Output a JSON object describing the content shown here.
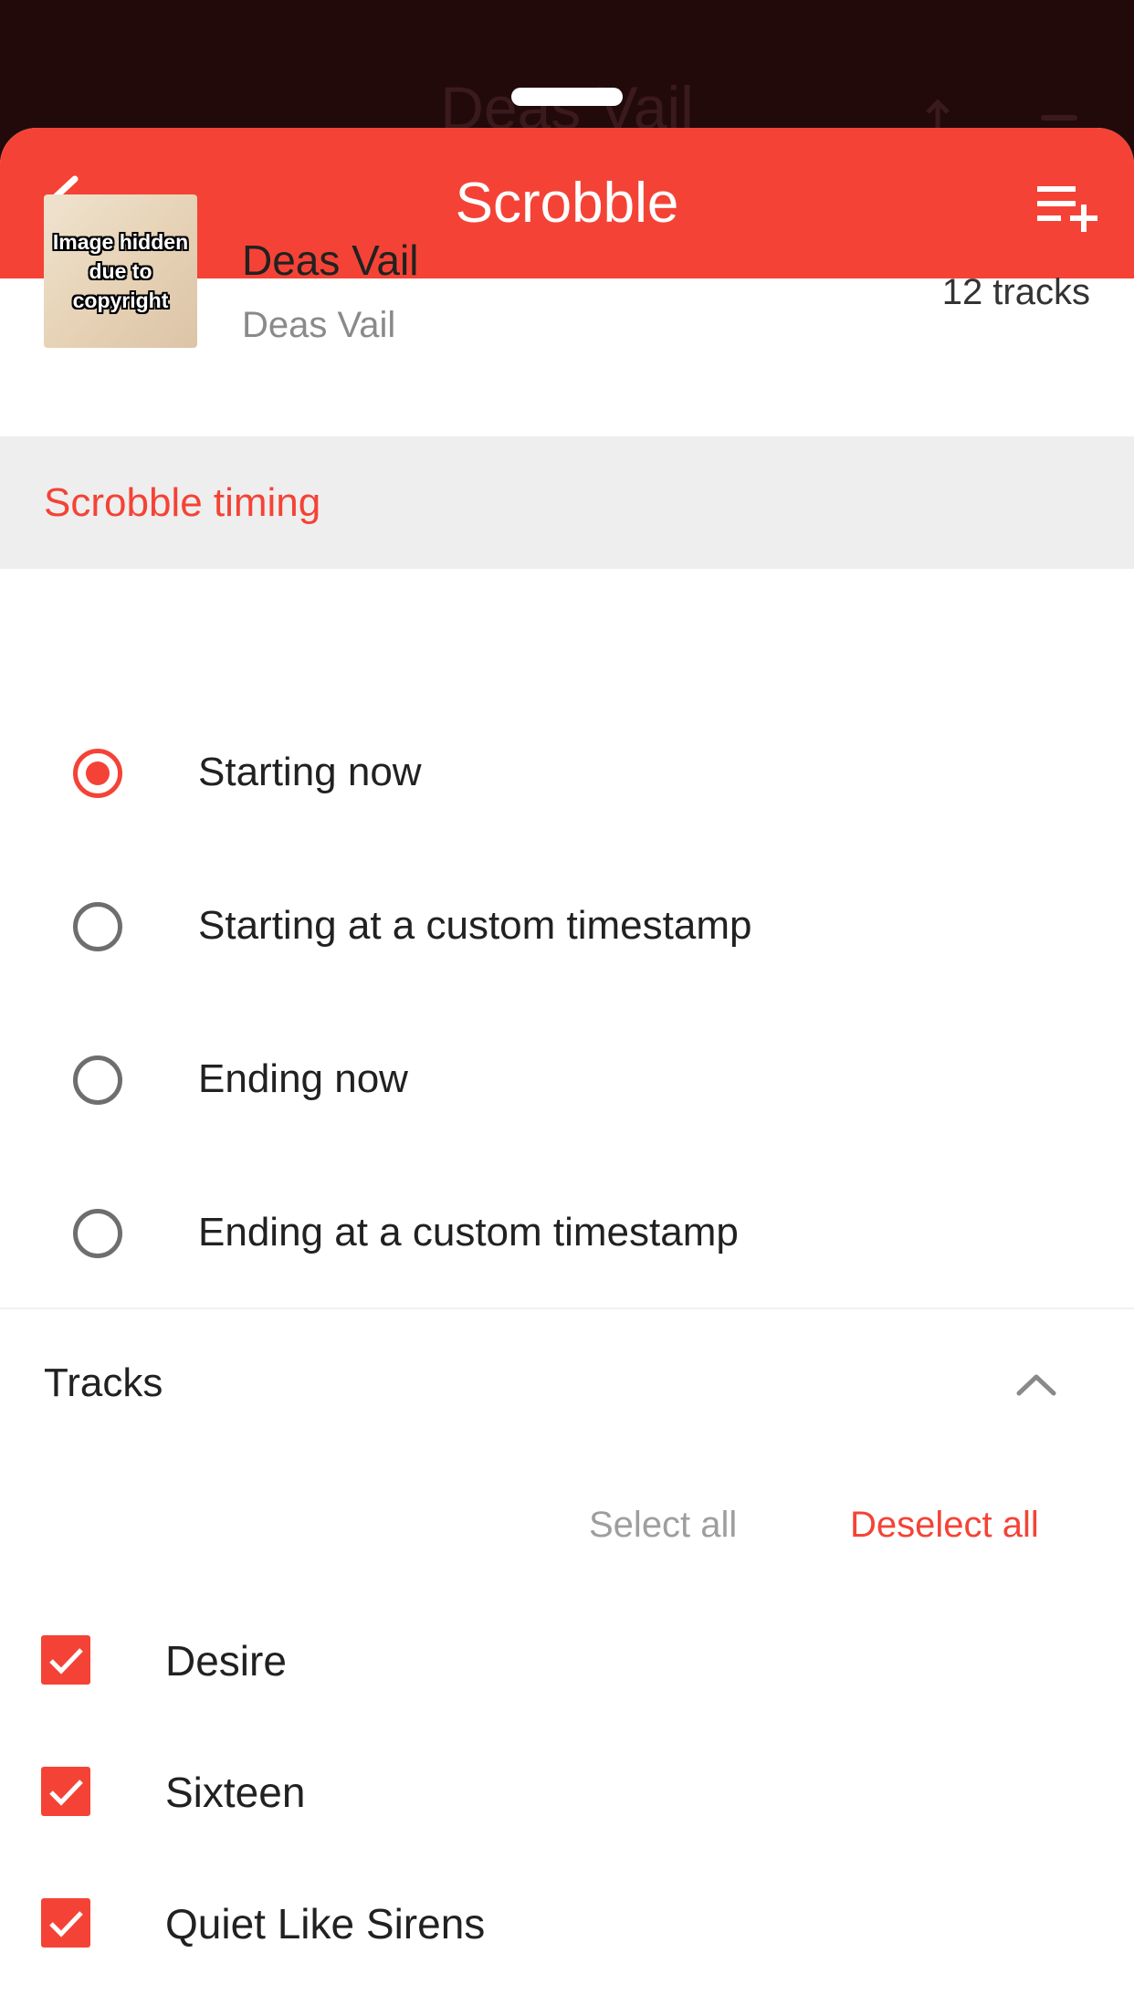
{
  "background": {
    "title": "Deas Vail"
  },
  "header": {
    "title": "Scrobble",
    "back_icon": "chevron-left-icon",
    "action_icon": "playlist-add-icon",
    "color": "#f44336"
  },
  "album": {
    "art_text": "Image hidden due to copyright",
    "title": "Deas Vail",
    "artist": "Deas Vail",
    "track_count": "12 tracks"
  },
  "scrobble_timing": {
    "heading": "Scrobble timing",
    "options": [
      {
        "label": "Starting now",
        "selected": true
      },
      {
        "label": "Starting at a custom timestamp",
        "selected": false
      },
      {
        "label": "Ending now",
        "selected": false
      },
      {
        "label": "Ending at a custom timestamp",
        "selected": false
      }
    ]
  },
  "tracks": {
    "heading": "Tracks",
    "expanded": true,
    "select_all": "Select all",
    "deselect_all": "Deselect all",
    "items": [
      {
        "title": "Desire",
        "checked": true
      },
      {
        "title": "Sixteen",
        "checked": true
      },
      {
        "title": "Quiet Like Sirens",
        "checked": true
      }
    ]
  }
}
